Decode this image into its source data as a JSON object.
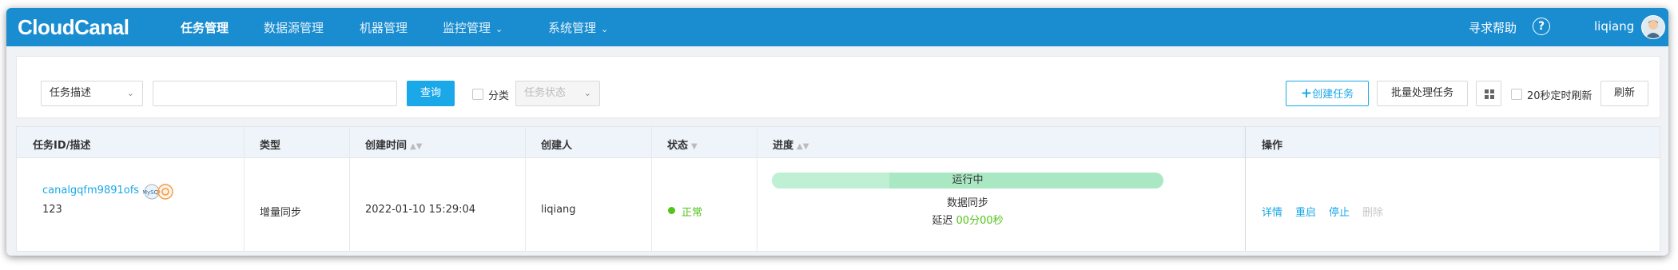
{
  "nav": {
    "logo": "CloudCanal",
    "items": [
      {
        "label": "任务管理",
        "active": true,
        "dropdown": false
      },
      {
        "label": "数据源管理",
        "active": false,
        "dropdown": false
      },
      {
        "label": "机器管理",
        "active": false,
        "dropdown": false
      },
      {
        "label": "监控管理",
        "active": false,
        "dropdown": true
      },
      {
        "label": "系统管理",
        "active": false,
        "dropdown": true
      }
    ],
    "help": "寻求帮助",
    "help_icon": "question-circle-icon",
    "user": "liqiang",
    "accent": "#1a8dd1"
  },
  "toolbar": {
    "filter_select": "任务描述",
    "search_value": "",
    "query_button": "查询",
    "category_label": "分类",
    "status_select_placeholder": "任务状态",
    "create_button": "创建任务",
    "batch_button": "批量处理任务",
    "auto_refresh_label": "20秒定时刷新",
    "refresh_button": "刷新"
  },
  "table": {
    "columns": [
      "任务ID/描述",
      "类型",
      "创建时间",
      "创建人",
      "状态",
      "进度",
      "操作"
    ],
    "rows": [
      {
        "task_id": "canalgqfm9891ofs",
        "description": "123",
        "type": "增量同步",
        "created_at": "2022-01-10 15:29:04",
        "creator": "liqiang",
        "status": "正常",
        "progress_label": "运行中",
        "progress_fraction": 0.3,
        "stage": "数据同步",
        "delay_label": "延迟",
        "delay_value": "00分00秒",
        "actions": [
          "详情",
          "重启",
          "停止",
          "删除"
        ]
      }
    ]
  },
  "colors": {
    "primary": "#1aa8e8",
    "success": "#52c41a",
    "progress": "#a9e8c2"
  }
}
